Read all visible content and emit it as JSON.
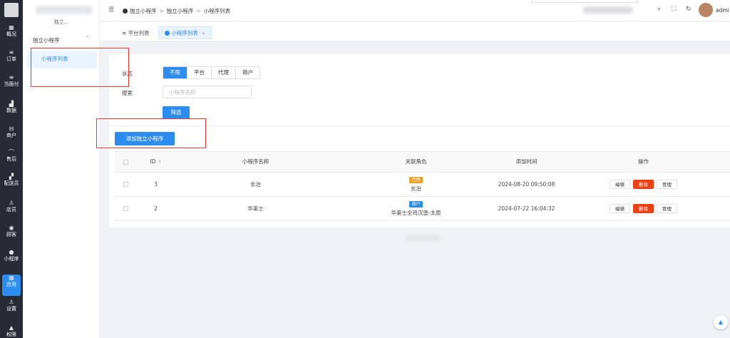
{
  "rail": {
    "items": [
      {
        "icon": "overview-icon",
        "glyph": "▦",
        "label": "概况"
      },
      {
        "icon": "order-icon",
        "glyph": "≡",
        "label": "订单"
      },
      {
        "icon": "pay-icon",
        "glyph": "≡",
        "label": "当面付"
      },
      {
        "icon": "data-icon",
        "glyph": "▟",
        "label": "数据"
      },
      {
        "icon": "merchant-icon",
        "glyph": "⊟",
        "label": "商户"
      },
      {
        "icon": "aftersale-icon",
        "glyph": "⌒",
        "label": "售后"
      },
      {
        "icon": "delivery-icon",
        "glyph": "▞",
        "label": "配送员"
      },
      {
        "icon": "staff-icon",
        "glyph": "♙",
        "label": "店员"
      },
      {
        "icon": "customer-icon",
        "glyph": "◉",
        "label": "顾客"
      },
      {
        "icon": "miniapp-icon",
        "glyph": "●",
        "label": "小程序"
      },
      {
        "icon": "apps-icon",
        "glyph": "▦",
        "label": "应用",
        "active": true
      },
      {
        "icon": "settings-icon",
        "glyph": "♙",
        "label": "设置"
      },
      {
        "icon": "permission-icon",
        "glyph": "▲",
        "label": "权限"
      }
    ]
  },
  "submenu": {
    "shop_label": "独立...",
    "group_label": "独立小程序",
    "item_label": "小程序列表"
  },
  "header": {
    "fold_glyph": "☰",
    "breadcrumb": [
      "独立小程序",
      "独立小程序",
      "小程序列表"
    ],
    "username": "admi",
    "tools": {
      "search": "⌕",
      "fullscreen": "⛶",
      "refresh": "↻"
    }
  },
  "tabs": [
    {
      "label": "平台列表",
      "icon": "≡"
    },
    {
      "label": "小程序列表",
      "close": "×",
      "active": true
    }
  ],
  "filters": {
    "status_label": "状态",
    "status_options": [
      "不限",
      "平台",
      "代理",
      "商户"
    ],
    "status_selected": "不限",
    "search_label": "搜索",
    "search_placeholder": "小程序名称",
    "filter_button": "筛选"
  },
  "add_button": "添加独立小程序",
  "table": {
    "headers": [
      "ID",
      "小程序名称",
      "关联角色",
      "添加时间",
      "操作"
    ],
    "sort_glyph": "⇕",
    "rows": [
      {
        "id": "3",
        "name": "长治",
        "role_tag": "代理",
        "role_tag_color": "#f0a020",
        "role_name": "长治",
        "time": "2024-08-20 09:50:08"
      },
      {
        "id": "2",
        "name": "华莱士",
        "role_tag": "商户",
        "role_tag_color": "#2d8cf0",
        "role_name": "华莱士全鸡汉堡-太原",
        "time": "2024-07-22 16:04:32"
      }
    ],
    "actions": [
      "编辑",
      "删除",
      "管理"
    ]
  },
  "colors": {
    "primary": "#2d8cf0",
    "danger": "#ed4014",
    "annotation": "#e53935"
  }
}
